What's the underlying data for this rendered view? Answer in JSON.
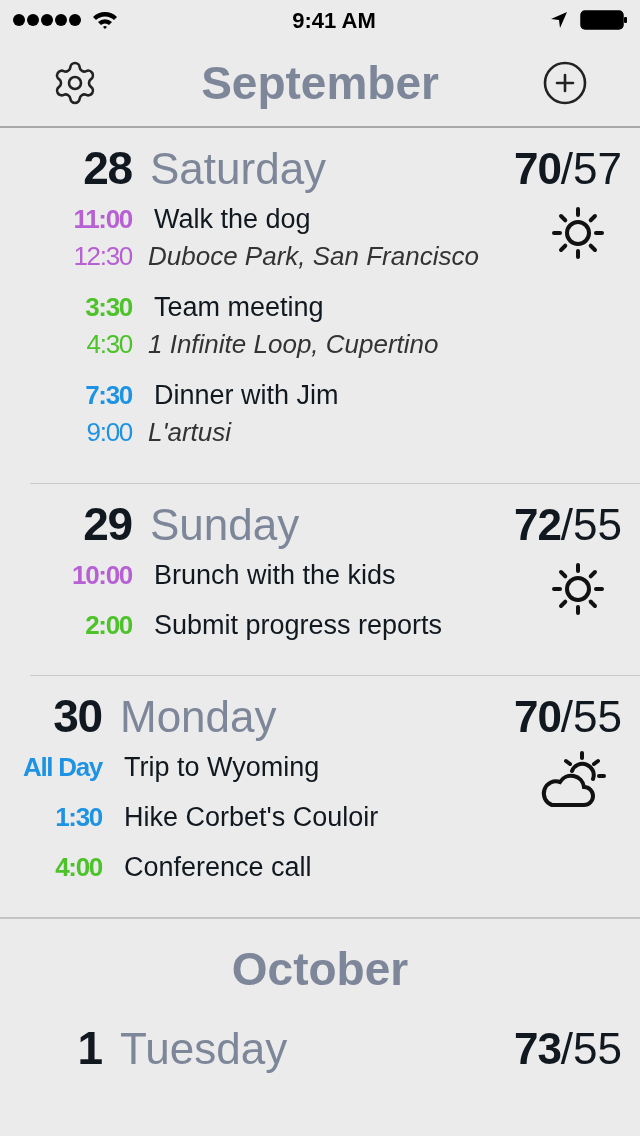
{
  "status_bar": {
    "time": "9:41 AM"
  },
  "nav": {
    "title": "September"
  },
  "feed": [
    {
      "kind": "day",
      "number": "28",
      "weekday": "Saturday",
      "high": "70",
      "low": "/57",
      "weather": {
        "kind": "sunny"
      },
      "events": [
        {
          "start": "11:00",
          "end": "12:30",
          "title": "Walk the dog",
          "location": "Duboce Park, San Francisco",
          "color": "#b760d4"
        },
        {
          "start": "3:30",
          "end": "4:30",
          "title": "Team meeting",
          "location": "1 Infinite Loop, Cupertino",
          "color": "#4dc22b"
        },
        {
          "start": "7:30",
          "end": "9:00",
          "title": "Dinner with Jim",
          "location": "L'artusi",
          "color": "#1f93e3"
        }
      ]
    },
    {
      "kind": "day",
      "number": "29",
      "weekday": "Sunday",
      "high": "72",
      "low": "/55",
      "weather": {
        "kind": "sunny"
      },
      "events": [
        {
          "start": "10:00",
          "title": "Brunch with the kids",
          "color": "#b760d4"
        },
        {
          "start": "2:00",
          "title": "Submit progress reports",
          "color": "#4dc22b"
        }
      ]
    },
    {
      "kind": "day",
      "number": "30",
      "weekday": "Monday",
      "high": "70",
      "low": "/55",
      "weather": {
        "kind": "partly_cloudy"
      },
      "events": [
        {
          "start": "All Day",
          "title": "Trip to Wyoming",
          "color": "#1f93e3"
        },
        {
          "start": "1:30",
          "title": "Hike Corbet's Couloir",
          "color": "#1f93e3"
        },
        {
          "start": "4:00",
          "title": "Conference call",
          "color": "#4dc22b"
        }
      ]
    },
    {
      "kind": "month",
      "title": "October"
    },
    {
      "kind": "day",
      "number": "1",
      "weekday": "Tuesday",
      "high": "73",
      "low": "/55"
    }
  ]
}
